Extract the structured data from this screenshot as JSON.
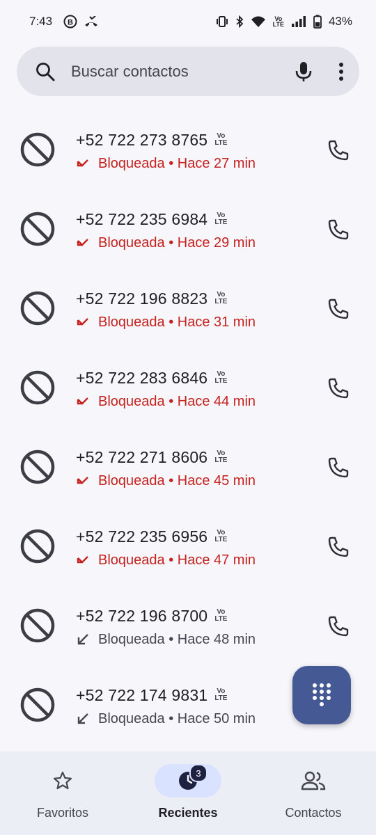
{
  "status_bar": {
    "time": "7:43",
    "battery": "43%",
    "left_icons": [
      "b-badge-icon",
      "call-forward-icon"
    ],
    "right_icons": [
      "vibrate-icon",
      "bluetooth-icon",
      "wifi-icon",
      "volte-icon",
      "signal-icon",
      "battery-icon"
    ],
    "volte_top": "Vo",
    "volte_bottom": "LTE"
  },
  "search": {
    "placeholder": "Buscar contactos",
    "icons": [
      "search-icon",
      "mic-icon",
      "more-vert-icon"
    ]
  },
  "calls": [
    {
      "number": "+52 722 273 8765",
      "detail": "Bloqueada • Hace 27 min",
      "missed": true
    },
    {
      "number": "+52 722 235 6984",
      "detail": "Bloqueada • Hace 29 min",
      "missed": true
    },
    {
      "number": "+52 722 196 8823",
      "detail": "Bloqueada • Hace 31 min",
      "missed": true
    },
    {
      "number": "+52 722 283 6846",
      "detail": "Bloqueada • Hace 44 min",
      "missed": true
    },
    {
      "number": "+52 722 271 8606",
      "detail": "Bloqueada • Hace 45 min",
      "missed": true
    },
    {
      "number": "+52 722 235 6956",
      "detail": "Bloqueada • Hace 47 min",
      "missed": true
    },
    {
      "number": "+52 722 196 8700",
      "detail": "Bloqueada • Hace 48 min",
      "missed": false
    },
    {
      "number": "+52 722 174 9831",
      "detail": "Bloqueada • Hace 50 min",
      "missed": false
    }
  ],
  "volte_tag": {
    "top": "Vo",
    "bottom": "LTE"
  },
  "fab": {
    "icon": "dialpad-icon"
  },
  "nav": {
    "items": [
      {
        "label": "Favoritos",
        "icon": "star-icon",
        "active": false
      },
      {
        "label": "Recientes",
        "icon": "clock-icon",
        "active": true,
        "badge": "3"
      },
      {
        "label": "Contactos",
        "icon": "people-icon",
        "active": false
      }
    ]
  },
  "colors": {
    "missed": "#c5221f",
    "fab": "#455a94",
    "active_pill": "#d9e2ff",
    "search_bg": "#e3e3ec"
  }
}
